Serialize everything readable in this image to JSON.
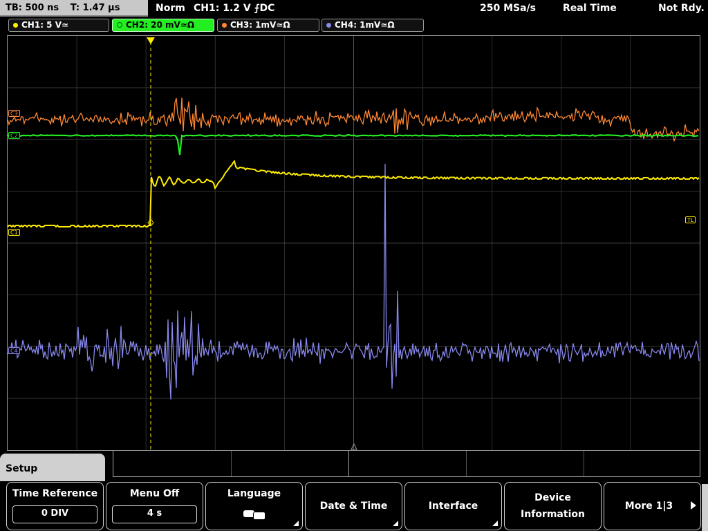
{
  "topbar": {
    "timebase": "TB: 500 ns",
    "trigger_pos": "T: 1.47 µs",
    "trigger_mode": "Norm",
    "trigger_info": "CH1: 1.2 V ⨍DC",
    "sample_rate": "250 MSa/s",
    "acq_mode": "Real Time",
    "state": "Not Rdy."
  },
  "channels": [
    {
      "label": "CH1: 5 V≃",
      "color": "#ffee00"
    },
    {
      "label": "CH2: 20 mV≃Ω",
      "color": "#22ee22"
    },
    {
      "label": "CH3: 1mV≃Ω",
      "color": "#ff8833"
    },
    {
      "label": "CH4: 1mV≃Ω",
      "color": "#8888ee"
    }
  ],
  "markers": {
    "c3": "C3",
    "c2": "C2",
    "c1": "C1",
    "c4": "C4",
    "tl": "TL",
    "trigger": "T"
  },
  "menu": {
    "title": "Setup",
    "buttons": [
      {
        "label": "Time Reference",
        "value": "0 DIV"
      },
      {
        "label": "Menu Off",
        "value": "4 s"
      },
      {
        "label": "Language",
        "icon": "speech-bubbles-icon"
      },
      {
        "label": "Date & Time"
      },
      {
        "label": "Interface"
      },
      {
        "label": "Device",
        "label2": "Information"
      },
      {
        "label": "More 1|3"
      }
    ]
  }
}
